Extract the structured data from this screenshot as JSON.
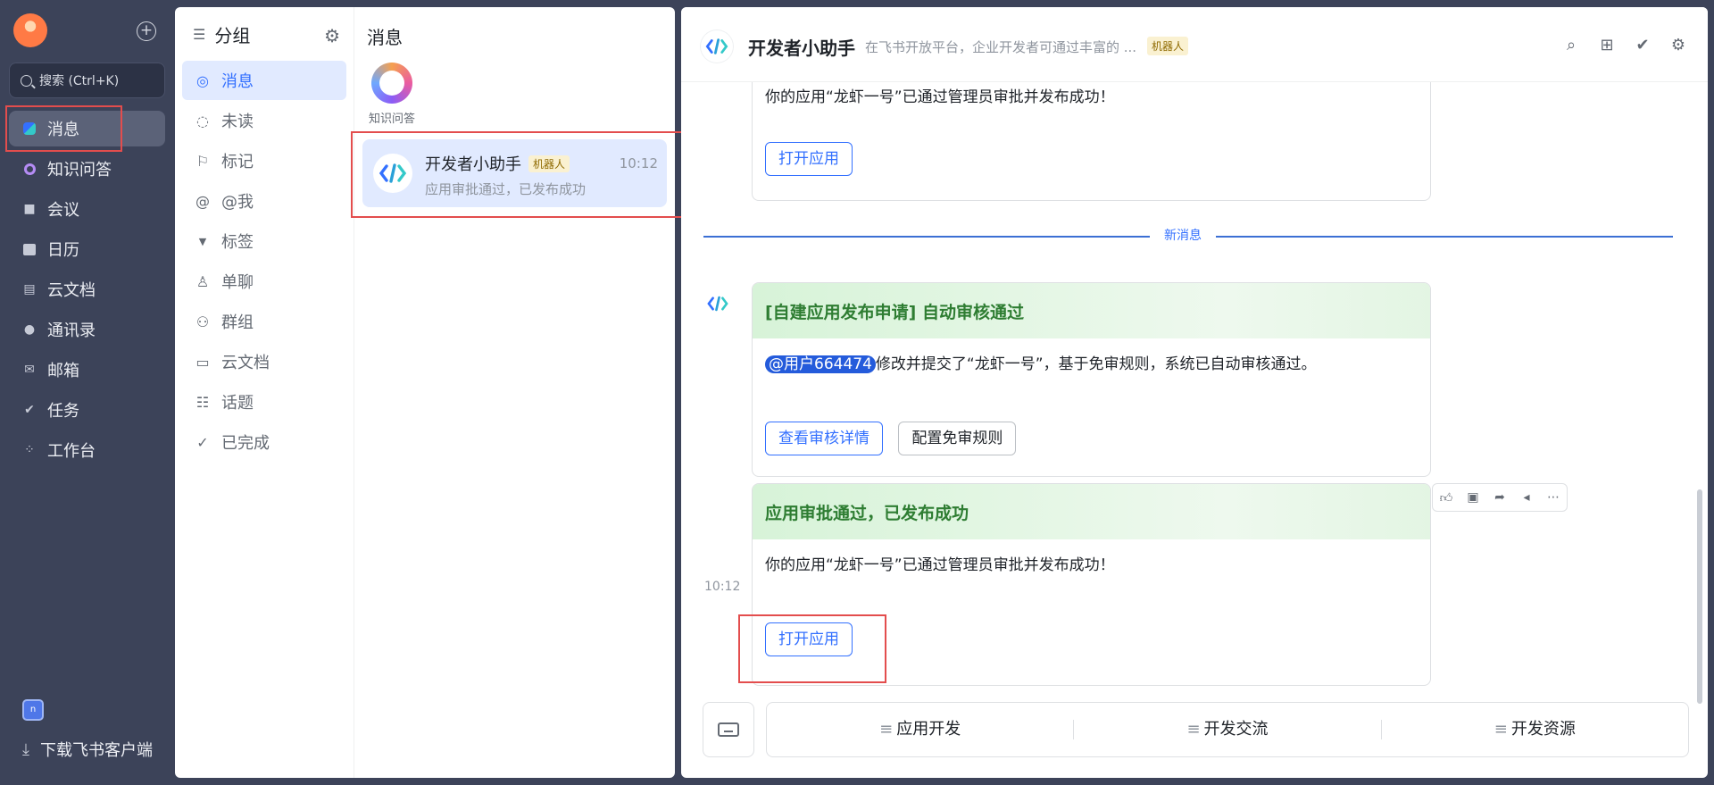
{
  "nav": {
    "search_label": "搜索 (Ctrl+K)",
    "items": [
      {
        "label": "消息",
        "icon": "message-icon"
      },
      {
        "label": "知识问答",
        "icon": "ai-answer-icon"
      },
      {
        "label": "会议",
        "icon": "video-icon"
      },
      {
        "label": "日历",
        "icon": "calendar-icon"
      },
      {
        "label": "云文档",
        "icon": "docs-icon"
      },
      {
        "label": "通讯录",
        "icon": "contacts-icon"
      },
      {
        "label": "邮箱",
        "icon": "mail-icon"
      },
      {
        "label": "任务",
        "icon": "task-icon"
      },
      {
        "label": "工作台",
        "icon": "workplace-icon"
      }
    ],
    "app_badge": "n",
    "download_label": "下载飞书客户端"
  },
  "groups": {
    "title": "分组",
    "items": [
      {
        "label": "消息"
      },
      {
        "label": "未读"
      },
      {
        "label": "标记"
      },
      {
        "label": "@我"
      },
      {
        "label": "标签"
      },
      {
        "label": "单聊"
      },
      {
        "label": "群组"
      },
      {
        "label": "云文档"
      },
      {
        "label": "话题"
      },
      {
        "label": "已完成"
      }
    ]
  },
  "chatlist": {
    "title": "消息",
    "pinned_label": "知识问答",
    "item": {
      "name": "开发者小助手",
      "tag": "机器人",
      "time": "10:12",
      "preview": "应用审批通过，已发布成功"
    }
  },
  "chat": {
    "title": "开发者小助手",
    "description": "在飞书开放平台，企业开发者可通过丰富的 ...",
    "tag": "机器人",
    "prev_card": {
      "text": "你的应用“龙虾一号”已通过管理员审批并发布成功！",
      "button": "打开应用"
    },
    "divider_label": "新消息",
    "card1": {
      "title": "[自建应用发布申请] 自动审核通过",
      "mention": "@用户664474",
      "text": "修改并提交了“龙虾一号”，基于免审规则，系统已自动审核通过。",
      "button_primary": "查看审核详情",
      "button_default": "配置免审规则"
    },
    "card2": {
      "title": "应用审批通过，已发布成功",
      "text": "你的应用“龙虾一号”已通过管理员审批并发布成功！",
      "button": "打开应用"
    },
    "message_time": "10:12",
    "menu": [
      "应用开发",
      "开发交流",
      "开发资源"
    ]
  },
  "colors": {
    "accent": "#3370ff",
    "nav_bg": "#3c4359",
    "highlight_box": "#e34d4d",
    "card_header_green": "#2e7d32"
  }
}
